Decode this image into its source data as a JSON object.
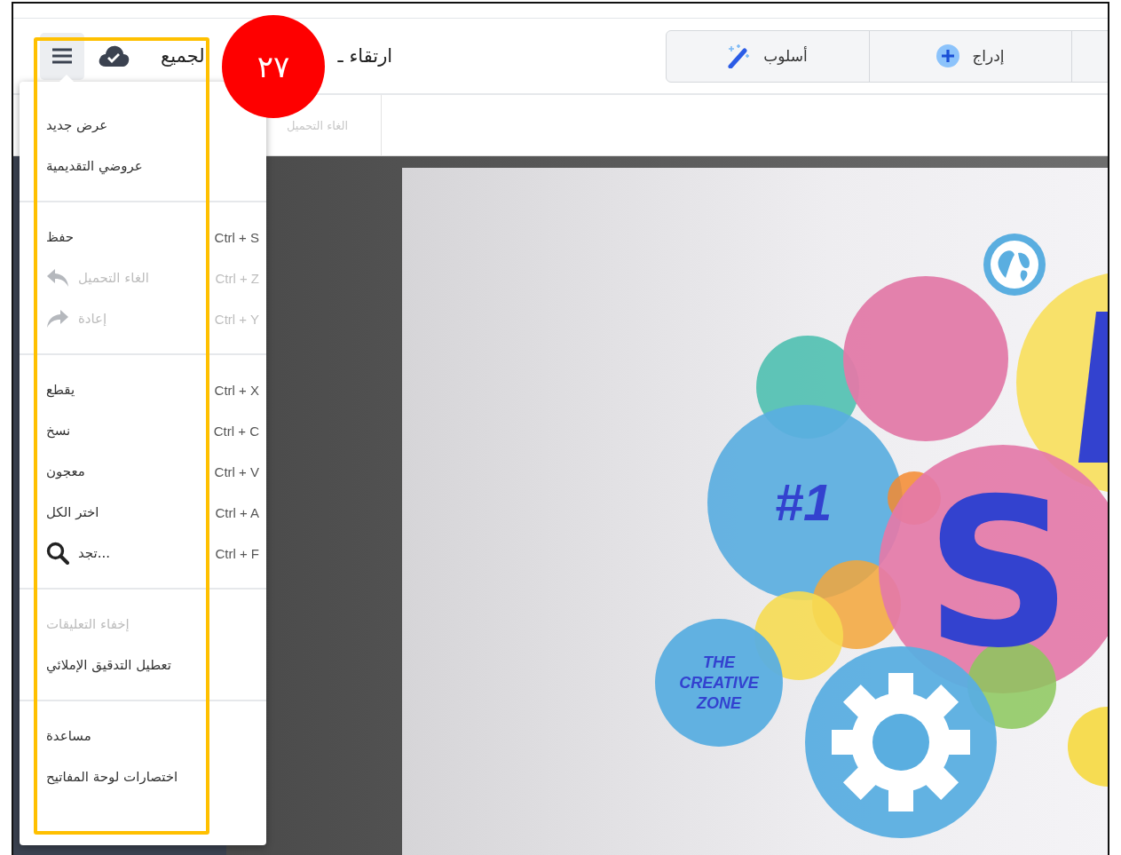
{
  "header": {
    "menu_button": {
      "expanded": true
    },
    "title_parts": [
      "ارتقاء ـ",
      "لجميع"
    ],
    "toolbar": [
      {
        "kind": "partial"
      },
      {
        "kind": "insert",
        "label": "إدراج"
      },
      {
        "kind": "style",
        "label": "أسلوب"
      }
    ]
  },
  "secondary_toolbar": {
    "items": [
      {
        "label": "الغاء التحميل",
        "disabled": true
      }
    ]
  },
  "menu": {
    "groups": [
      {
        "items": [
          {
            "kind": "plain",
            "label": "عرض جديد",
            "disabled": false
          },
          {
            "kind": "plain",
            "label": "عروضي التقديمية",
            "disabled": false
          }
        ]
      },
      {
        "items": [
          {
            "kind": "plain",
            "label": "حفظ",
            "shortcut": "Ctrl + S",
            "disabled": false
          },
          {
            "kind": "undo",
            "label": "الغاء التحميل",
            "shortcut": "Ctrl + Z",
            "disabled": true
          },
          {
            "kind": "redo",
            "label": "إعادة",
            "shortcut": "Ctrl + Y",
            "disabled": true
          }
        ]
      },
      {
        "items": [
          {
            "kind": "plain",
            "label": "يقطع",
            "shortcut": "Ctrl + X",
            "disabled": false
          },
          {
            "kind": "plain",
            "label": "نسخ",
            "shortcut": "Ctrl + C",
            "disabled": false
          },
          {
            "kind": "plain",
            "label": "معجون",
            "shortcut": "Ctrl + V",
            "disabled": false
          },
          {
            "kind": "plain",
            "label": "اختر الكل",
            "shortcut": "Ctrl + A",
            "disabled": false
          },
          {
            "kind": "search",
            "label": "...تجد",
            "shortcut": "Ctrl + F",
            "disabled": false
          }
        ]
      },
      {
        "items": [
          {
            "kind": "plain",
            "label": "إخفاء التعليقات",
            "disabled": true
          },
          {
            "kind": "plain",
            "label": "تعطيل التدقيق الإملائي",
            "disabled": false
          }
        ]
      },
      {
        "items": [
          {
            "kind": "plain",
            "label": "مساعدة",
            "disabled": false
          },
          {
            "kind": "plain",
            "label": "اختصارات لوحة المفاتيح",
            "disabled": false
          }
        ]
      }
    ]
  },
  "slide": {
    "badge": "#1",
    "letter": "S",
    "caption_lines": [
      "THE",
      "CREATIVE",
      "ZONE"
    ]
  },
  "annotation": {
    "number": "٢٧"
  }
}
